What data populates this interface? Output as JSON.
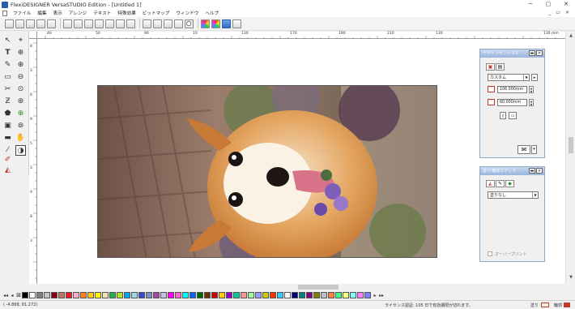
{
  "window": {
    "title": "FlexiDESIGNER VersaSTUDIO Edition - [Untitled 1]",
    "minimize": "─",
    "maximize": "▢",
    "close": "✕"
  },
  "menu": {
    "items": [
      "ファイル",
      "編集",
      "表示",
      "アレンジ",
      "テキスト",
      "特殊効果",
      "ビットマップ",
      "ウィンドウ",
      "ヘルプ"
    ],
    "mdi_minimize": "_",
    "mdi_restore": "▭",
    "mdi_close": "×"
  },
  "ruler": {
    "top_labels": [
      "40",
      "50",
      "90",
      "10",
      "130",
      "170",
      "190",
      "210",
      "130"
    ],
    "top_last": "130 mm",
    "left_labels": [
      "8",
      "3",
      "8",
      "9",
      "5",
      "3",
      "9",
      "8",
      "3"
    ]
  },
  "design_panel": {
    "title": "デザインセントラル",
    "preset": "カスタム",
    "width_value": "106.000mm",
    "height_value": "60.000mm"
  },
  "fill_panel": {
    "title": "塗り/輪郭エディタ",
    "fill_value": "塗りなし",
    "overprint_label": "オーバープリント"
  },
  "palette": {
    "nav_first": "◂◂",
    "nav_prev": "◂",
    "nav_next": "▸",
    "nav_last": "▸▸",
    "colors": [
      "#000000",
      "#ffffff",
      "#7f7f7f",
      "#c3c3c3",
      "#880015",
      "#b97a57",
      "#ed1c24",
      "#ffaec9",
      "#ff7f27",
      "#ffc90e",
      "#fff200",
      "#efe4b0",
      "#22b14c",
      "#b5e61d",
      "#00a2e8",
      "#99d9ea",
      "#3f48cc",
      "#7092be",
      "#a349a4",
      "#c8bfe7",
      "#ff00ff",
      "#ff66cc",
      "#00ffff",
      "#0066ff",
      "#006600",
      "#663300",
      "#cc0000",
      "#ffcc00",
      "#9900cc",
      "#00cc99",
      "#ff9999",
      "#99ff99",
      "#9999ff",
      "#cccc00",
      "#ff3300",
      "#33ccff",
      "#ffffff",
      "#000080",
      "#008080",
      "#800080",
      "#808000",
      "#c0c0c0",
      "#ff8040",
      "#40ff80",
      "#ffff80",
      "#80ffff",
      "#ff80ff",
      "#8080ff"
    ]
  },
  "status": {
    "coords": "( -4.888, 81.272)",
    "hint": "ライセンス認証: 105 日で有効期限が切れます。",
    "fill_label": "塗り",
    "stroke_label": "輪郭"
  }
}
